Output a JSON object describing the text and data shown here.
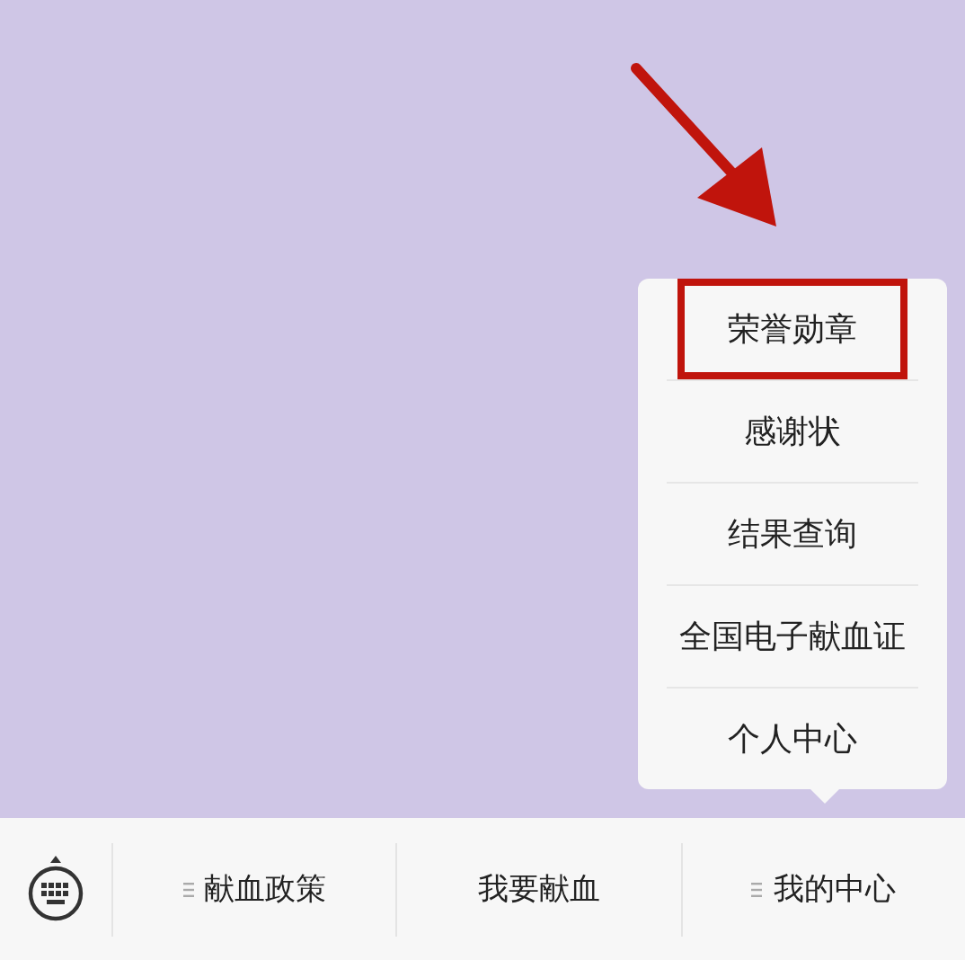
{
  "popup_menu": {
    "items": [
      {
        "label": "荣誉勋章",
        "highlighted": true
      },
      {
        "label": "感谢状",
        "highlighted": false
      },
      {
        "label": "结果查询",
        "highlighted": false
      },
      {
        "label": "全国电子献血证",
        "highlighted": false
      },
      {
        "label": "个人中心",
        "highlighted": false
      }
    ]
  },
  "bottom_menu": {
    "tabs": [
      {
        "label": "献血政策",
        "submenu": true
      },
      {
        "label": "我要献血",
        "submenu": false
      },
      {
        "label": "我的中心",
        "submenu": true
      }
    ]
  }
}
